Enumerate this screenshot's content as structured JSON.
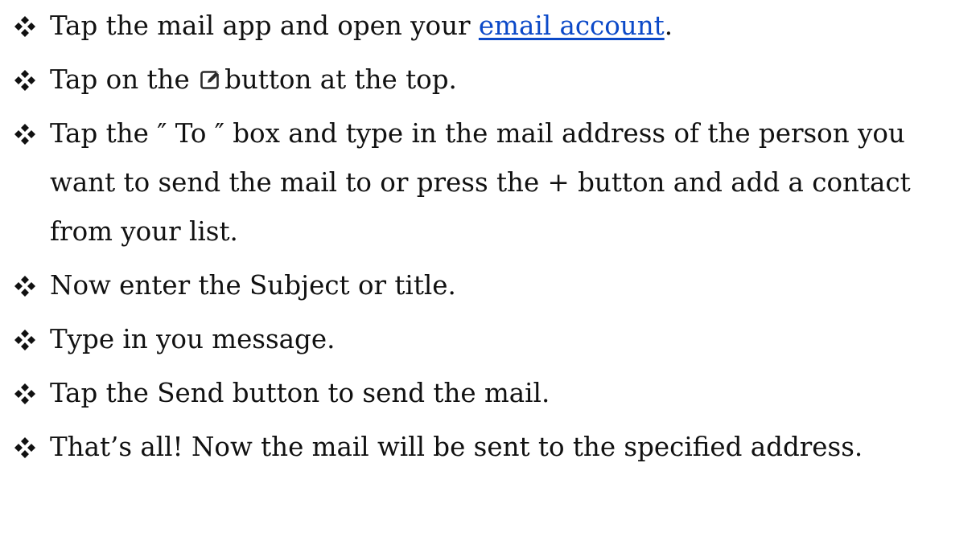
{
  "bullet_icon": "four-diamond-bullet-icon",
  "link_color": "#0b49c8",
  "steps": [
    {
      "before": "Tap the mail app and open your ",
      "link": "email account",
      "after": "."
    },
    {
      "before": "Tap on the ",
      "icon": "compose-icon",
      "after": "button at the top."
    },
    {
      "text": "Tap the ″ To ″ box and type in the mail address of the person you want to send the mail to or press the + button and add a contact from your list."
    },
    {
      "text": "Now enter the Subject or title."
    },
    {
      "text": "Type in you message."
    },
    {
      "text": "Tap the Send button to send the mail."
    },
    {
      "text": "That’s all! Now the mail will be sent to the specified address."
    }
  ]
}
